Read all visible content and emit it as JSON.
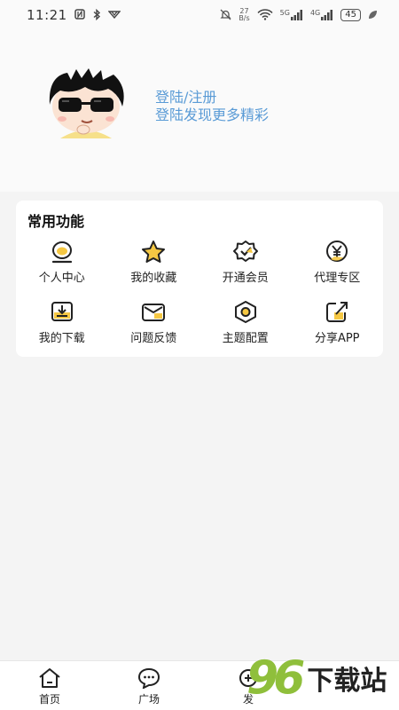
{
  "status_bar": {
    "time": "11:21",
    "net_speed_value": "27",
    "net_speed_unit": "B/s",
    "net_5g": "5G",
    "net_4g": "4G",
    "battery": "45"
  },
  "profile": {
    "login_title": "登陆/注册",
    "login_subtitle": "登陆发现更多精彩"
  },
  "common_functions": {
    "title": "常用功能",
    "items": [
      {
        "label": "个人中心",
        "icon": "user-center-icon"
      },
      {
        "label": "我的收藏",
        "icon": "star-icon"
      },
      {
        "label": "开通会员",
        "icon": "vip-badge-icon"
      },
      {
        "label": "代理专区",
        "icon": "yen-coin-icon"
      },
      {
        "label": "我的下载",
        "icon": "download-icon"
      },
      {
        "label": "问题反馈",
        "icon": "feedback-mail-icon"
      },
      {
        "label": "主题配置",
        "icon": "theme-hexagon-icon"
      },
      {
        "label": "分享APP",
        "icon": "share-icon"
      }
    ]
  },
  "tabbar": {
    "items": [
      {
        "label": "首页",
        "icon": "home-icon"
      },
      {
        "label": "广场",
        "icon": "chat-bubble-icon"
      },
      {
        "label": "发",
        "icon": "publish-icon"
      }
    ]
  },
  "watermark": {
    "number": "96",
    "text": "下载站"
  },
  "colors": {
    "accent_yellow": "#f6c843",
    "link_blue": "#5a9bd6",
    "page_bg": "#f4f4f4",
    "watermark_green": "#8fbf3b"
  }
}
